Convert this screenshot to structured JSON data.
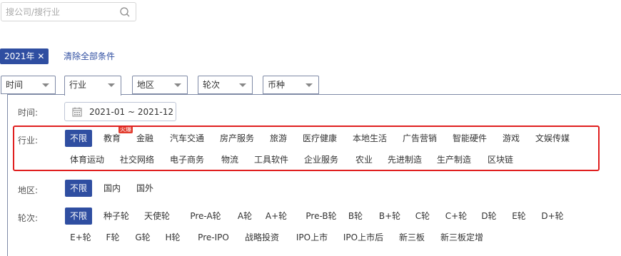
{
  "search": {
    "placeholder": "搜公司/搜行业"
  },
  "selected_tags": [
    {
      "label": "2021年 ✕"
    }
  ],
  "clear_all_label": "清除全部条件",
  "filter_dropdowns": [
    "时间",
    "行业",
    "地区",
    "轮次",
    "币种"
  ],
  "panel": {
    "time": {
      "label": "时间:",
      "date_range": "2021-01 ~ 2021-12"
    },
    "industry": {
      "label": "行业:",
      "badge": "火爆",
      "options": [
        "不限",
        "教育",
        "金融",
        "汽车交通",
        "房产服务",
        "旅游",
        "医疗健康",
        "本地生活",
        "广告营销",
        "智能硬件",
        "游戏",
        "文娱传媒",
        "体育运动",
        "社交网络",
        "电子商务",
        "物流",
        "工具软件",
        "企业服务",
        "农业",
        "先进制造",
        "生产制造",
        "区块链"
      ]
    },
    "region": {
      "label": "地区:",
      "options": [
        "不限",
        "国内",
        "国外"
      ]
    },
    "round": {
      "label": "轮次:",
      "options": [
        "不限",
        "种子轮",
        "天使轮",
        "Pre-A轮",
        "A轮",
        "A+轮",
        "Pre-B轮",
        "B轮",
        "B+轮",
        "C轮",
        "C+轮",
        "D轮",
        "E轮",
        "D+轮",
        "E+轮",
        "F轮",
        "G轮",
        "H轮",
        "Pre-IPO",
        "战略投资",
        "IPO上市",
        "IPO上市后",
        "新三板",
        "新三板定增"
      ]
    }
  },
  "colors": {
    "accent": "#2f4ea1",
    "highlight_frame": "#e01f1f",
    "badge": "#e23c2e"
  }
}
